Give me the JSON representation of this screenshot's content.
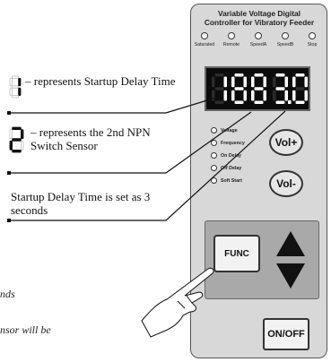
{
  "controller": {
    "title_line1": "Variable Voltage Digital",
    "title_line2": "Controller for Vibratory Feeder",
    "indicators": [
      "Saturated",
      "Remote",
      "SpeedA",
      "SpeedB",
      "Stop"
    ],
    "display_digits": [
      "1",
      "8",
      "8",
      "3",
      "0"
    ],
    "functions": [
      "Voltage",
      "Frequency",
      "On Delay",
      "Off Delay",
      "Soft Start"
    ],
    "vol_plus_label": "Vol+",
    "vol_minus_label": "Vol-",
    "func_label": "FUNC",
    "onoff_label": "ON/OFF",
    "display_color": "#ffffff",
    "panel_color": "#d8d8d8"
  },
  "annotations": {
    "a1_symbol": "1",
    "a1_text": "represents Startup Delay Time",
    "a2_symbol": "2",
    "a2_text": "represents the 2nd NPN Switch Sensor",
    "a3_text": "Startup Delay Time is set as 3 seconds",
    "partial1": "nds",
    "partial2": "nsor will be"
  }
}
